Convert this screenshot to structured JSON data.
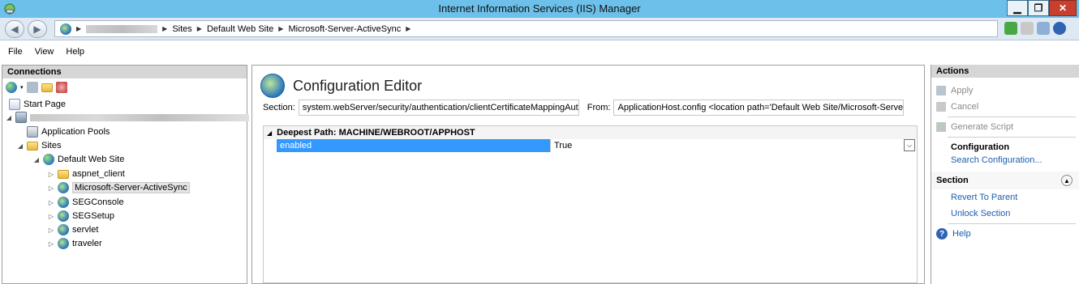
{
  "window": {
    "title": "Internet Information Services (IIS) Manager"
  },
  "address": {
    "crumbs": [
      "Sites",
      "Default Web Site",
      "Microsoft-Server-ActiveSync"
    ]
  },
  "menu": [
    "File",
    "View",
    "Help"
  ],
  "connections": {
    "title": "Connections",
    "tree": {
      "start_page": "Start Page",
      "app_pools": "Application Pools",
      "sites": "Sites",
      "default_site": "Default Web Site",
      "children": [
        "aspnet_client",
        "Microsoft-Server-ActiveSync",
        "SEGConsole",
        "SEGSetup",
        "servlet",
        "traveler"
      ]
    }
  },
  "editor": {
    "title": "Configuration Editor",
    "section_label": "Section:",
    "section_value": "system.webServer/security/authentication/clientCertificateMappingAuthent",
    "from_label": "From:",
    "from_value": "ApplicationHost.config <location path='Default Web Site/Microsoft-Server-",
    "group": "Deepest Path: MACHINE/WEBROOT/APPHOST",
    "row": {
      "name": "enabled",
      "value": "True"
    }
  },
  "actions": {
    "title": "Actions",
    "apply": "Apply",
    "cancel": "Cancel",
    "generate": "Generate Script",
    "configuration": "Configuration",
    "search": "Search Configuration...",
    "section": "Section",
    "revert": "Revert To Parent",
    "unlock": "Unlock Section",
    "help": "Help"
  }
}
